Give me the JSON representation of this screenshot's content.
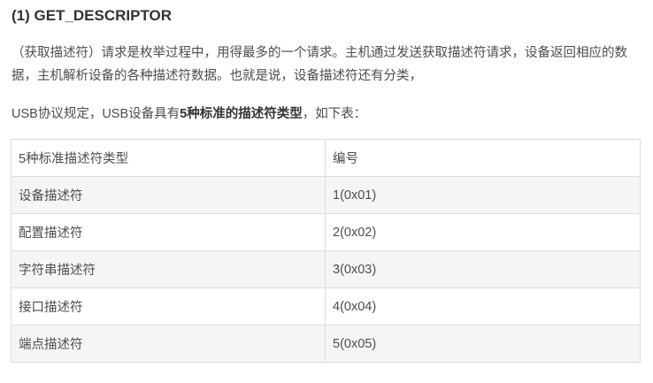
{
  "heading": "(1) GET_DESCRIPTOR",
  "paragraph1": "（获取描述符）请求是枚举过程中，用得最多的一个请求。主机通过发送获取描述符请求，设备返回相应的数据，主机解析设备的各种描述符数据。也就是说，设备描述符还有分类，",
  "paragraph2": {
    "before": "USB协议规定，USB设备具有",
    "bold": "5种标准的描述符类型",
    "after": "，如下表："
  },
  "table": {
    "headers": [
      "5种标准描述符类型",
      "编号"
    ],
    "rows": [
      [
        "设备描述符",
        "1(0x01)"
      ],
      [
        "配置描述符",
        "2(0x02)"
      ],
      [
        "字符串描述符",
        "3(0x03)"
      ],
      [
        "接口描述符",
        "4(0x04)"
      ],
      [
        "端点描述符",
        "5(0x05)"
      ]
    ]
  }
}
